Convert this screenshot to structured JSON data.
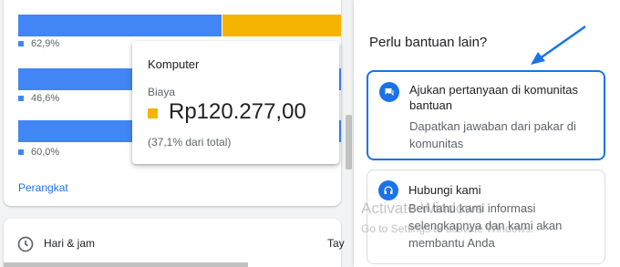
{
  "chart": {
    "rows": [
      {
        "percent_label": "62,9%",
        "segments": [
          {
            "color": "#4285f4",
            "share": 0.629
          },
          {
            "color": "#f4b400",
            "share": 0.371
          }
        ]
      },
      {
        "percent_label": "46,6%",
        "segments": [
          {
            "color": "#4285f4",
            "share": 1.0
          }
        ]
      },
      {
        "percent_label": "60,0%",
        "segments": [
          {
            "color": "#4285f4",
            "share": 1.0
          }
        ]
      }
    ],
    "link_label": "Perangkat"
  },
  "tooltip": {
    "title": "Komputer",
    "metric_label": "Biaya",
    "value": "Rp120.277,00",
    "share": "(37,1% dari total)",
    "swatch_color": "#f4b400"
  },
  "bottom_card": {
    "label": "Hari & jam",
    "right_label": "Tay",
    "icon": "clock-icon"
  },
  "help": {
    "title": "Perlu bantuan lain?",
    "options": [
      {
        "icon": "chat-icon",
        "title": "Ajukan pertanyaan di komunitas bantuan",
        "description": "Dapatkan jawaban dari pakar di komunitas"
      },
      {
        "icon": "headset-icon",
        "title": "Hubungi kami",
        "description": "Beri tahu kami informasi selengkapnya dan kami akan membantu Anda"
      }
    ]
  },
  "watermark": {
    "line1": "Activate Windows",
    "line2": "Go to Settings to activate Windows."
  },
  "colors": {
    "accent": "#1a73e8",
    "blue": "#4285f4",
    "yellow": "#f4b400"
  }
}
